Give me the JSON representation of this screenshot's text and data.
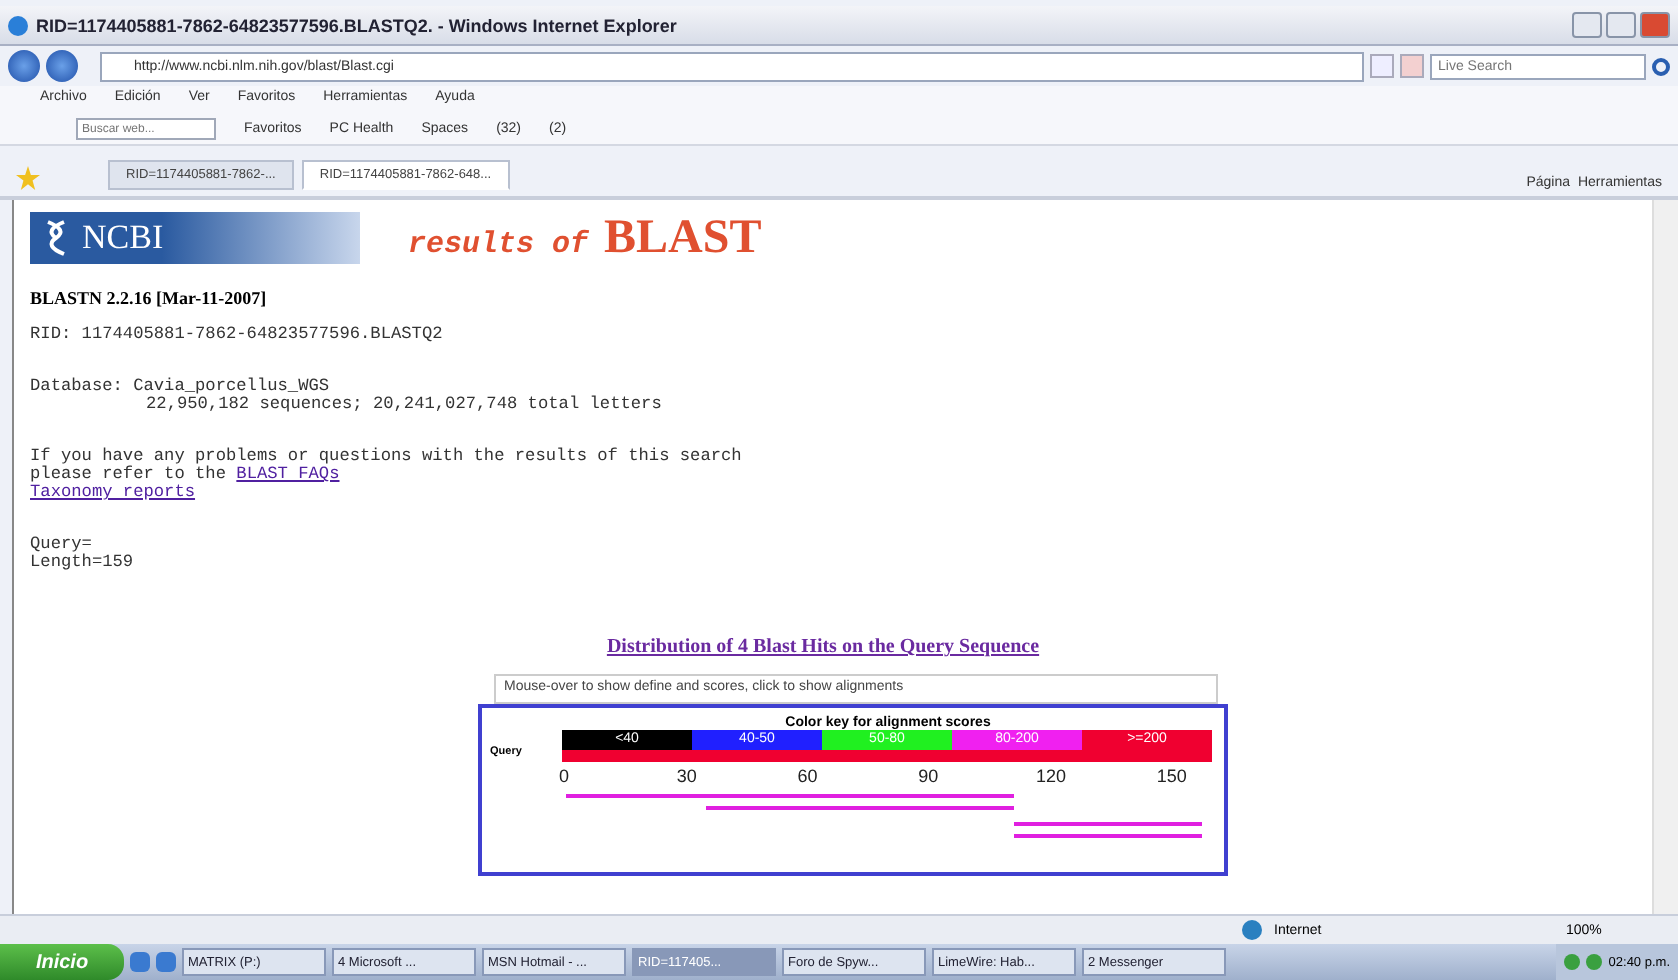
{
  "window": {
    "title": "RID=1174405881-7862-64823577596.BLASTQ2. - Windows Internet Explorer"
  },
  "address_bar": {
    "url": "http://www.ncbi.nlm.nih.gov/blast/Blast.cgi",
    "search_placeholder": "Live Search"
  },
  "menu": [
    "Archivo",
    "Edición",
    "Ver",
    "Favoritos",
    "Herramientas",
    "Ayuda"
  ],
  "toolbar": {
    "search_placeholder": "Buscar web...",
    "items": [
      "Favoritos",
      "PC Health",
      "Spaces",
      "(32)",
      "(2)"
    ]
  },
  "tabs": [
    {
      "label": "RID=1174405881-7862-...",
      "selected": false
    },
    {
      "label": "RID=1174405881-7862-648...",
      "selected": true
    }
  ],
  "command_bar": [
    "Página",
    "Herramientas"
  ],
  "page": {
    "logo": "NCBI",
    "title_prefix": "results of",
    "title_main": "BLAST",
    "version": "BLASTN 2.2.16 [Mar-11-2007]",
    "rid": "RID: 1174405881-7862-64823577596.BLASTQ2",
    "database": "Database: Cavia_porcellus_WGS",
    "db_stats": "22,950,182 sequences; 20,241,027,748 total letters",
    "help_line1": "If you have any problems or questions with the results of this search",
    "help_line2": "please refer to the",
    "faq_link": "BLAST FAQs",
    "taxonomy_link": "Taxonomy reports",
    "query": "Query=",
    "length": "Length=159",
    "distribution_title": "Distribution of 4 Blast Hits on the Query Sequence",
    "mouseover_hint": "Mouse-over to show define and scores, click to show alignments",
    "color_key_title": "Color key for alignment scores",
    "color_key": [
      {
        "label": "<40",
        "color": "#000000"
      },
      {
        "label": "40-50",
        "color": "#2020ff"
      },
      {
        "label": "50-80",
        "color": "#20f020"
      },
      {
        "label": "80-200",
        "color": "#f020f0"
      },
      {
        "label": ">=200",
        "color": "#f00030"
      }
    ],
    "query_label": "Query",
    "ticks": [
      "0",
      "30",
      "60",
      "90",
      "120",
      "150"
    ]
  },
  "status_bar": {
    "zone": "Internet",
    "zoom": "100%"
  },
  "taskbar": {
    "start": "Inicio",
    "items": [
      {
        "label": "MATRIX (P:)",
        "selected": false
      },
      {
        "label": "4 Microsoft ...",
        "selected": false
      },
      {
        "label": "MSN Hotmail - ...",
        "selected": false
      },
      {
        "label": "RID=117405...",
        "selected": true
      },
      {
        "label": "Foro de Spyw...",
        "selected": false
      },
      {
        "label": "LimeWire: Hab...",
        "selected": false
      },
      {
        "label": "2 Messenger",
        "selected": false
      }
    ],
    "clock": "02:40 p.m."
  }
}
